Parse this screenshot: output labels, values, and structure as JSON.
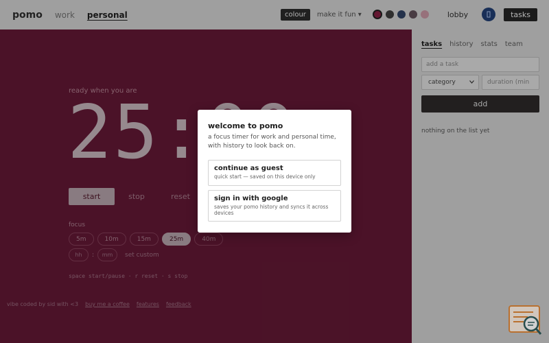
{
  "header": {
    "logo": "pomo",
    "tabs": [
      {
        "label": "work",
        "active": false
      },
      {
        "label": "personal",
        "active": true
      }
    ],
    "colour_button": "colour",
    "fun_button": "make it fun ▾",
    "swatches": [
      "#7a1e3e",
      "#3a3a3a",
      "#2d3e5c",
      "#5a4a52",
      "#b98a96"
    ],
    "lobby_button": "lobby",
    "profile_icon": "user-icon",
    "tasks_button": "tasks"
  },
  "timer": {
    "status": "ready when you are",
    "display": "25:00",
    "start_label": "start",
    "stop_label": "stop",
    "reset_label": "reset",
    "focus_label": "focus",
    "presets": [
      "5m",
      "10m",
      "15m",
      "25m",
      "40m"
    ],
    "selected_preset": "25m",
    "custom_hh_placeholder": "hh",
    "custom_sep": ":",
    "custom_mm_placeholder": "mm",
    "set_custom_label": "set custom",
    "shortcuts": "space start/pause · r reset · s stop"
  },
  "footer": {
    "credit": "vibe coded by sid with <3",
    "buy_coffee": "buy me a coffee",
    "features": "features",
    "feedback": "feedback"
  },
  "panel": {
    "tabs": [
      {
        "label": "tasks",
        "active": true
      },
      {
        "label": "history",
        "active": false
      },
      {
        "label": "stats",
        "active": false
      },
      {
        "label": "team",
        "active": false
      }
    ],
    "task_placeholder": "add a task",
    "category_value": "category",
    "duration_placeholder": "duration (min",
    "add_label": "add",
    "empty_message": "nothing on the list yet"
  },
  "modal": {
    "title": "welcome to pomo",
    "description": "a focus timer for work and personal time, with history to look back on.",
    "guest_title": "continue as guest",
    "guest_sub": "quick start — saved on this device only",
    "google_title": "sign in with google",
    "google_sub": "saves your pomo history and syncs it across devices"
  },
  "colors": {
    "main_bg": "#5c1731",
    "panel_bg": "#c2c2c2",
    "accent_dark": "#222222"
  }
}
